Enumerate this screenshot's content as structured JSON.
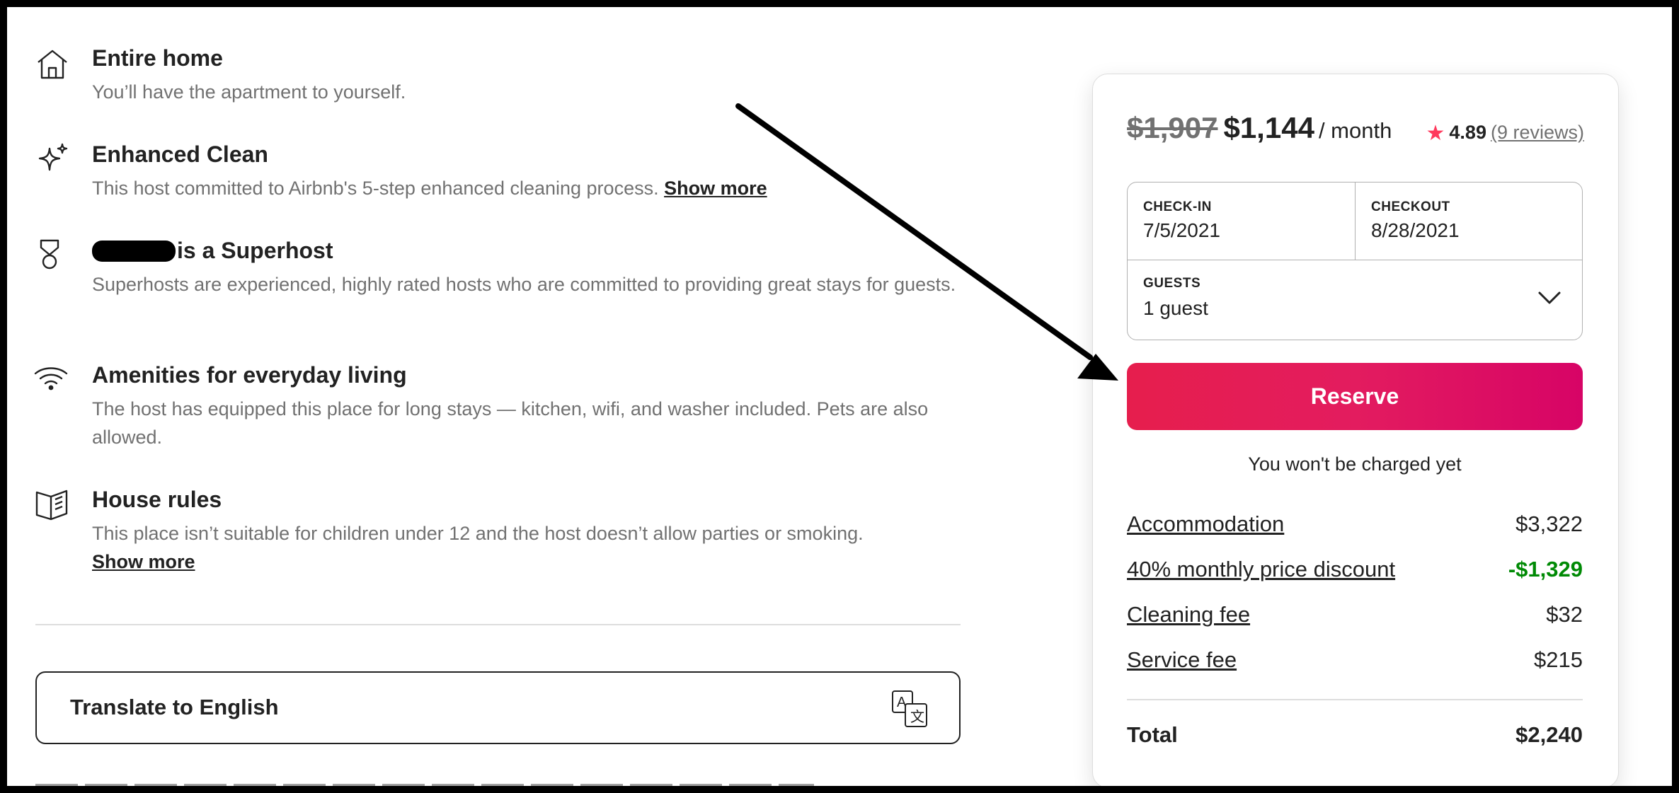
{
  "highlights": [
    {
      "icon": "house-icon",
      "title": "Entire home",
      "desc": "You’ll have the apartment to yourself."
    },
    {
      "icon": "sparkle-icon",
      "title": "Enhanced Clean",
      "desc": "This host committed to Airbnb's 5-step enhanced cleaning process.",
      "link": "Show more"
    },
    {
      "icon": "medal-icon",
      "title": "is a Superhost",
      "desc": "Superhosts are experienced, highly rated hosts who are committed to providing great stays for guests."
    },
    {
      "icon": "wifi-icon",
      "title": "Amenities for everyday living",
      "desc": "The host has equipped this place for long stays — kitchen, wifi, and washer included. Pets are also allowed."
    },
    {
      "icon": "book-icon",
      "title": "House rules",
      "desc": "This place isn’t suitable for children under 12 and the host doesn’t allow parties or smoking.",
      "link": "Show more"
    }
  ],
  "translate": {
    "label": "Translate to English",
    "icon": "translate-icon"
  },
  "booking": {
    "old_price": "$1,907",
    "price": "$1,144",
    "per": "/ month",
    "rating": "4.89",
    "reviews": "(9 reviews)",
    "checkin_label": "CHECK-IN",
    "checkin_value": "7/5/2021",
    "checkout_label": "CHECKOUT",
    "checkout_value": "8/28/2021",
    "guests_label": "GUESTS",
    "guests_value": "1 guest",
    "reserve": "Reserve",
    "note": "You won't be charged yet",
    "fees": [
      {
        "label": "Accommodation",
        "amount": "$3,322"
      },
      {
        "label": "40% monthly price discount",
        "amount": "-$1,329"
      },
      {
        "label": "Cleaning fee",
        "amount": "$32"
      },
      {
        "label": "Service fee",
        "amount": "$215"
      }
    ],
    "total_label": "Total",
    "total_amount": "$2,240"
  },
  "colors": {
    "brand": "#ff385c",
    "reserve_start": "#e61e4d",
    "reserve_end": "#d70466",
    "discount": "#008a05",
    "muted": "#717171"
  }
}
